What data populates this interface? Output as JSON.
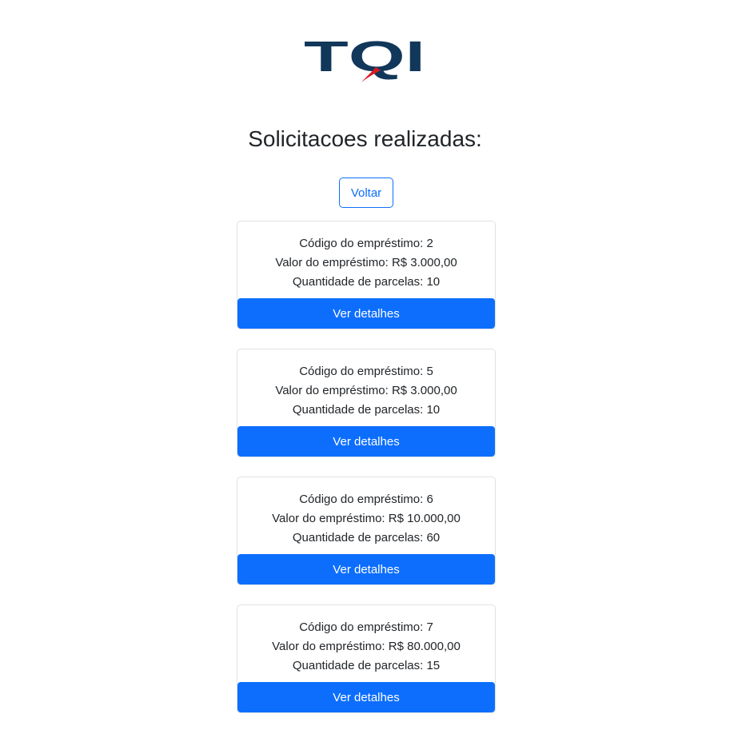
{
  "logo": {
    "text": "TQI"
  },
  "title": "Solicitacoes realizadas:",
  "back_label": "Voltar",
  "colors": {
    "brand_navy": "#11375a",
    "brand_red": "#d71920",
    "primary": "#0d6efd"
  },
  "loans": [
    {
      "code_line": "Código do empréstimo: 2",
      "value_line": "Valor do empréstimo: R$ 3.000,00",
      "installments_line": "Quantidade de parcelas: 10",
      "button_label": "Ver detalhes"
    },
    {
      "code_line": "Código do empréstimo: 5",
      "value_line": "Valor do empréstimo: R$ 3.000,00",
      "installments_line": "Quantidade de parcelas: 10",
      "button_label": "Ver detalhes"
    },
    {
      "code_line": "Código do empréstimo: 6",
      "value_line": "Valor do empréstimo: R$ 10.000,00",
      "installments_line": "Quantidade de parcelas: 60",
      "button_label": "Ver detalhes"
    },
    {
      "code_line": "Código do empréstimo: 7",
      "value_line": "Valor do empréstimo: R$ 80.000,00",
      "installments_line": "Quantidade de parcelas: 15",
      "button_label": "Ver detalhes"
    }
  ]
}
